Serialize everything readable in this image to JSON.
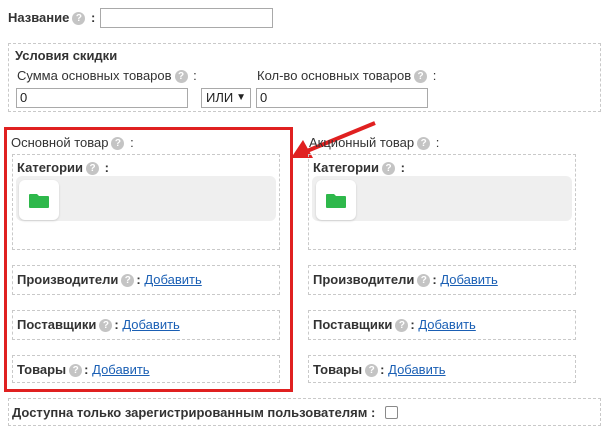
{
  "name_field": {
    "label": "Название",
    "value": "",
    "help": "?"
  },
  "discount": {
    "title": "Условия скидки",
    "sum_label": "Сумма основных товаров",
    "sum_value": "0",
    "operator": "ИЛИ",
    "count_label": "Кол-во основных товаров",
    "count_value": "0"
  },
  "main_product": {
    "title": "Основной товар",
    "categories_label": "Категории",
    "manufacturers_label": "Производители",
    "suppliers_label": "Поставщики",
    "products_label": "Товары",
    "add_label": "Добавить"
  },
  "promo_product": {
    "title": "Акционный товар",
    "categories_label": "Категории",
    "manufacturers_label": "Производители",
    "suppliers_label": "Поставщики",
    "products_label": "Товары",
    "add_label": "Добавить"
  },
  "registered_only": {
    "label": "Доступна только зарегистрированным пользователям",
    "checked": false
  },
  "colors": {
    "highlight": "#e02020",
    "folder": "#2eb84b",
    "link": "#1a5fb4"
  },
  "icons": [
    "help-icon",
    "folder-icon",
    "arrow-annotation",
    "chevron-down-icon"
  ]
}
